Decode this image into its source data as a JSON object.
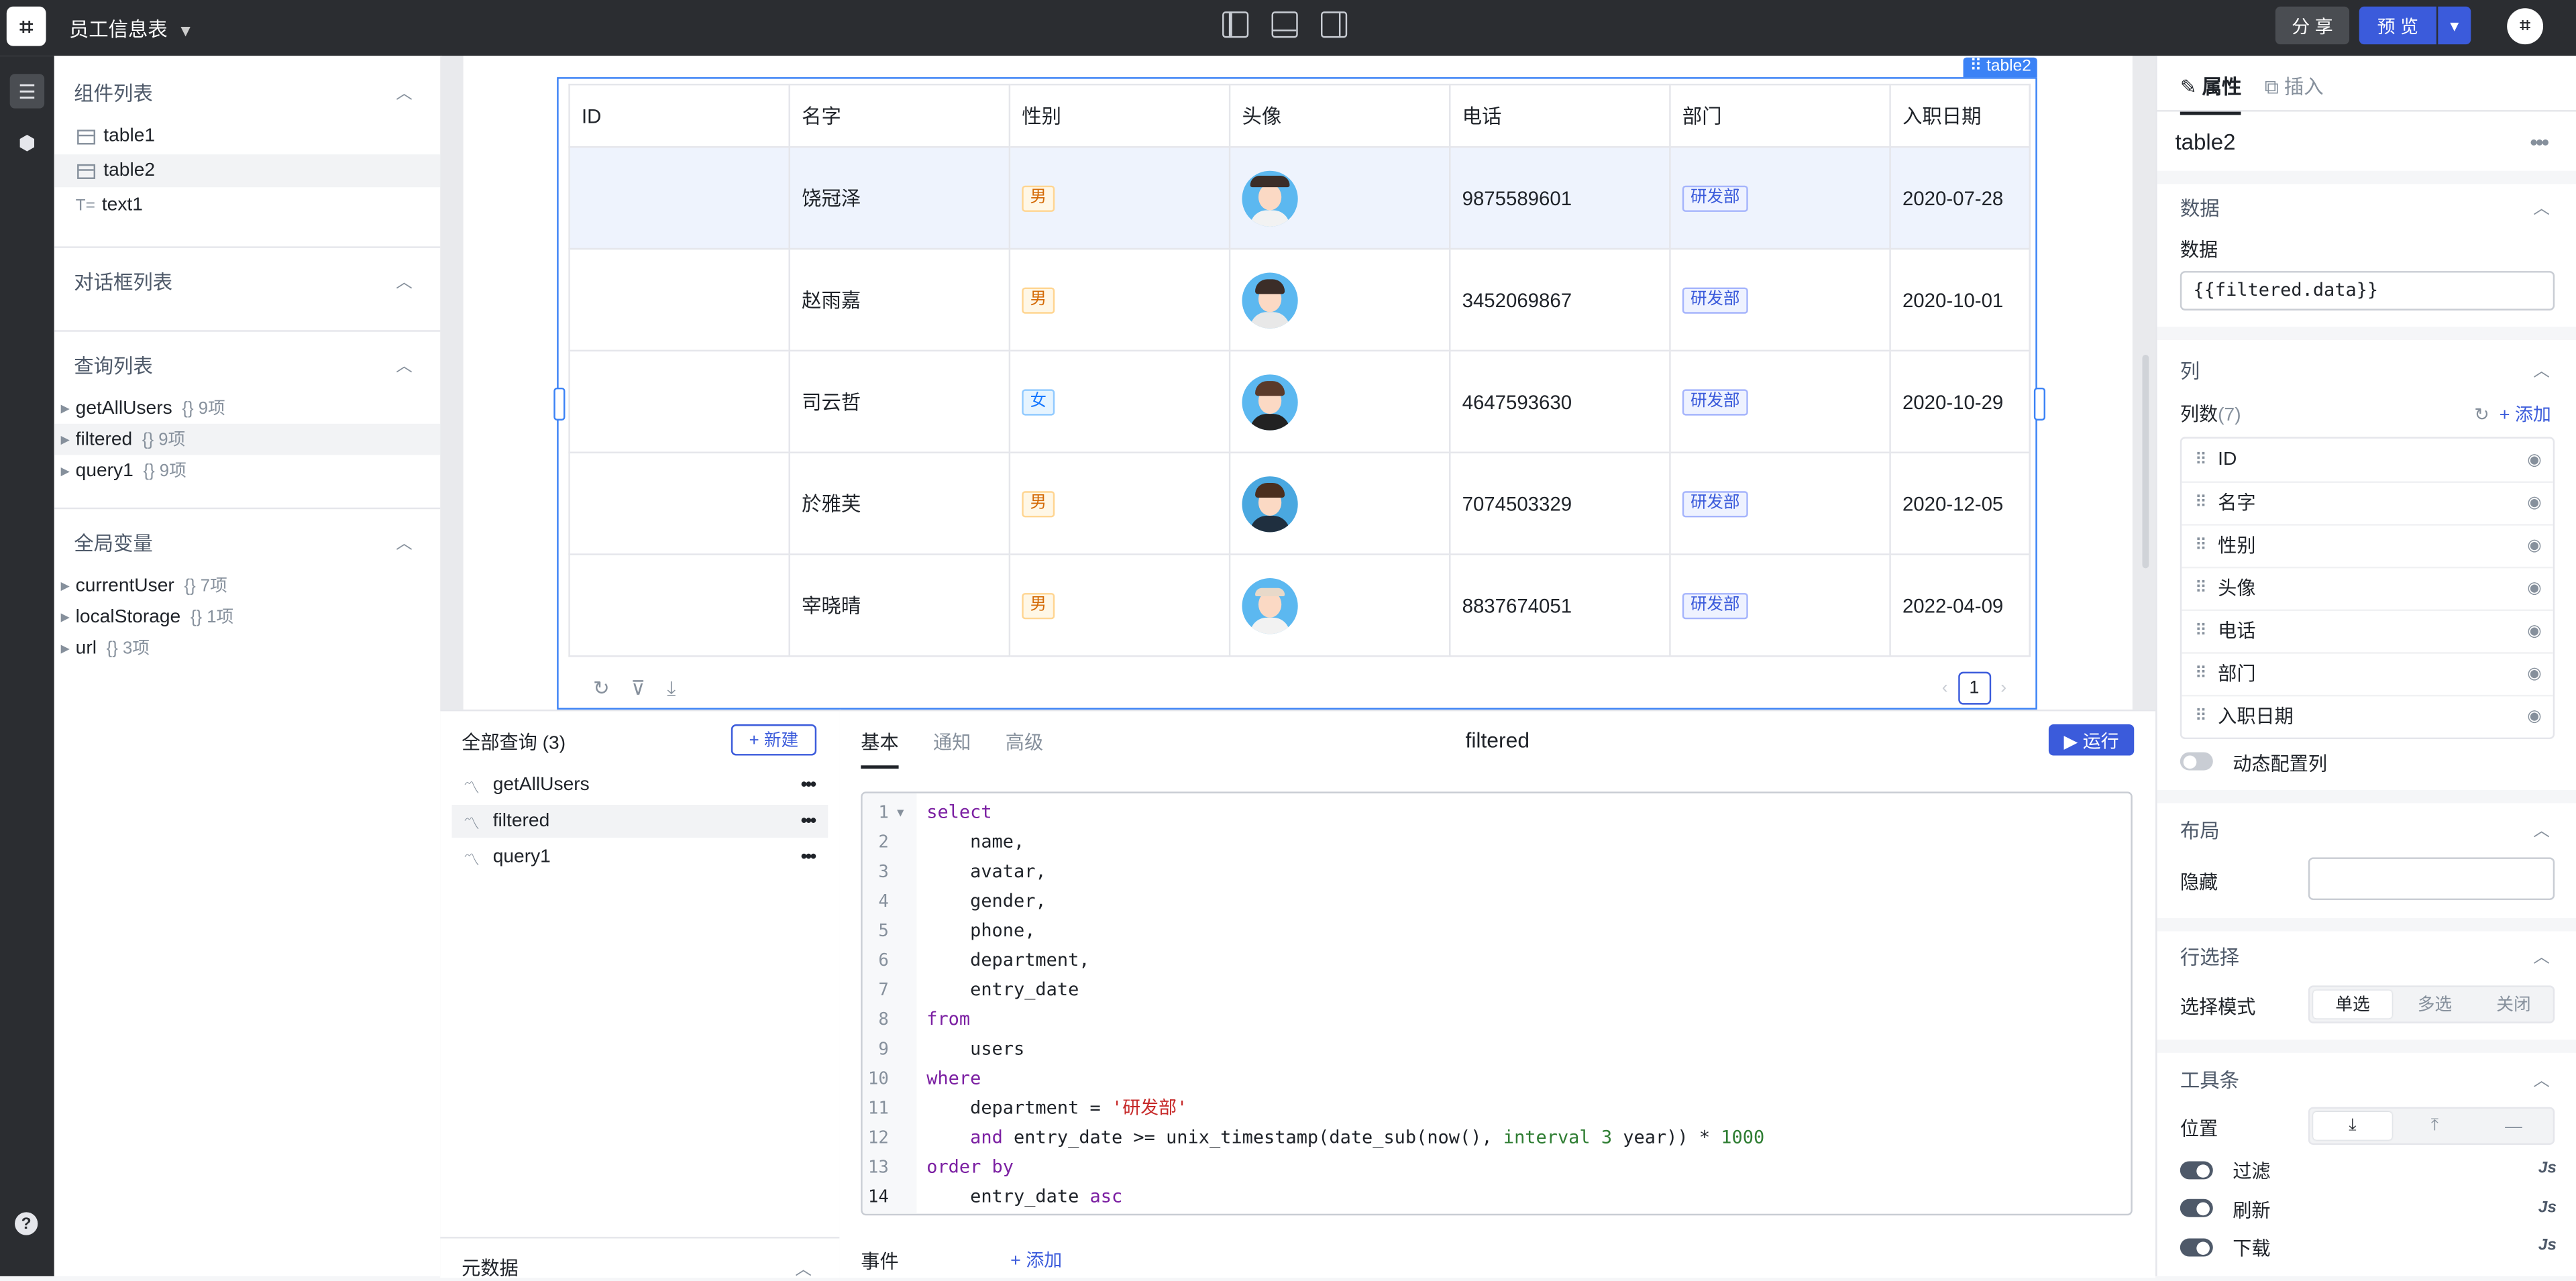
{
  "app": {
    "title": "员工信息表",
    "logo": "logo-icon",
    "share_label": "分 享",
    "preview_label": "预 览"
  },
  "left": {
    "components_title": "组件列表",
    "components": [
      {
        "label": "table1",
        "icon": "table-icon"
      },
      {
        "label": "table2",
        "icon": "table-icon"
      },
      {
        "label": "text1",
        "icon": "text-icon"
      }
    ],
    "dialogs_title": "对话框列表",
    "queries_title": "查询列表",
    "queries": [
      {
        "name": "getAllUsers",
        "meta": "{} 9项"
      },
      {
        "name": "filtered",
        "meta": "{} 9项"
      },
      {
        "name": "query1",
        "meta": "{} 9项"
      }
    ],
    "globals_title": "全局变量",
    "globals": [
      {
        "name": "currentUser",
        "meta": "{} 7项"
      },
      {
        "name": "localStorage",
        "meta": "{} 1项"
      },
      {
        "name": "url",
        "meta": "{} 3项"
      }
    ]
  },
  "table": {
    "tag": "⠿ table2",
    "columns": [
      "ID",
      "名字",
      "性别",
      "头像",
      "电话",
      "部门",
      "入职日期"
    ],
    "rows": [
      {
        "id": "",
        "name": "饶冠泽",
        "gender": "男",
        "phone": "9875589601",
        "dept": "研发部",
        "date": "2020-07-28"
      },
      {
        "id": "",
        "name": "赵雨嘉",
        "gender": "男",
        "phone": "3452069867",
        "dept": "研发部",
        "date": "2020-10-01"
      },
      {
        "id": "",
        "name": "司云哲",
        "gender": "女",
        "phone": "4647593630",
        "dept": "研发部",
        "date": "2020-10-29"
      },
      {
        "id": "",
        "name": "於雅芙",
        "gender": "男",
        "phone": "7074503329",
        "dept": "研发部",
        "date": "2020-12-05"
      },
      {
        "id": "",
        "name": "宰晓晴",
        "gender": "男",
        "phone": "8837674051",
        "dept": "研发部",
        "date": "2022-04-09"
      }
    ],
    "page": "1"
  },
  "queries_panel": {
    "title": "全部查询 (3)",
    "new_label": "+ 新建",
    "items": [
      "getAllUsers",
      "filtered",
      "query1"
    ],
    "metadata_label": "元数据"
  },
  "editor": {
    "tabs": [
      "基本",
      "通知",
      "高级"
    ],
    "title": "filtered",
    "run_label": "▶ 运行",
    "events_label": "事件",
    "events_add": "+ 添加",
    "lines": [
      "1",
      "2",
      "3",
      "4",
      "5",
      "6",
      "7",
      "8",
      "9",
      "10",
      "11",
      "12",
      "13",
      "14"
    ]
  },
  "right": {
    "tabs": [
      "属性",
      "插入"
    ],
    "name": "table2",
    "data_section": "数据",
    "data_label": "数据",
    "data_value": "{{filtered.data}}",
    "columns_section": "列",
    "columns_count_label": "列数",
    "columns_count": "(7)",
    "add_label": "+ 添加",
    "columns": [
      "ID",
      "名字",
      "性别",
      "头像",
      "电话",
      "部门",
      "入职日期"
    ],
    "dynamic_label": "动态配置列",
    "layout_section": "布局",
    "hide_label": "隐藏",
    "rowsel_section": "行选择",
    "select_mode_label": "选择模式",
    "select_modes": [
      "单选",
      "多选",
      "关闭"
    ],
    "toolbar_section": "工具条",
    "position_label": "位置",
    "toolbar_items": [
      "过滤",
      "刷新",
      "下载"
    ],
    "js_label": "Js"
  }
}
